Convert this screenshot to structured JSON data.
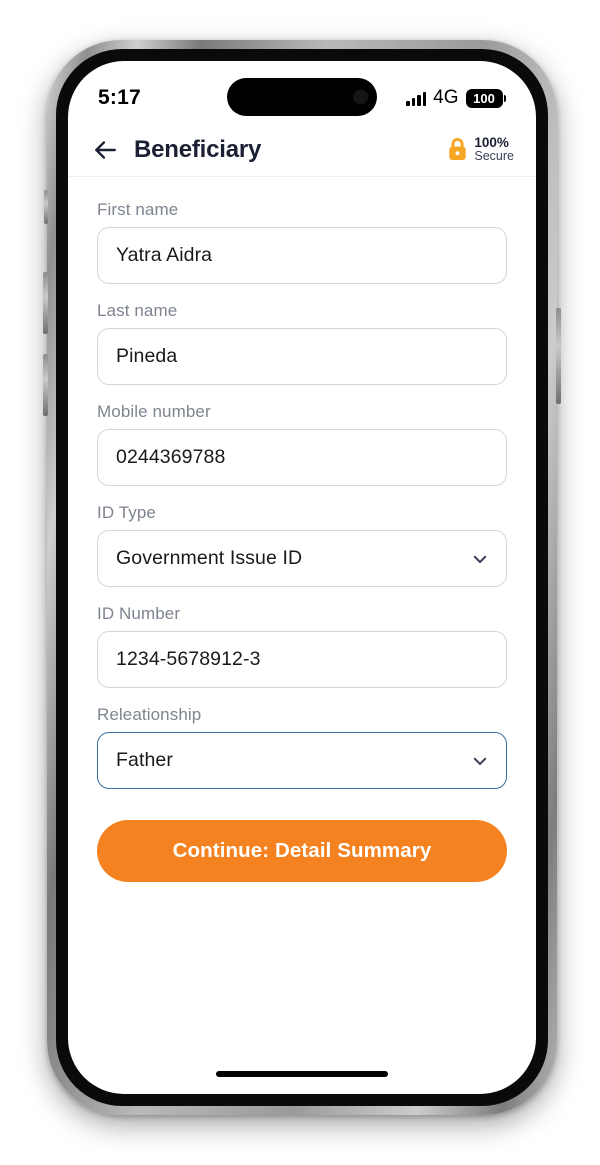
{
  "status_bar": {
    "time": "5:17",
    "network": "4G",
    "battery_level": "100",
    "signal_icon": "signal-bars-icon",
    "battery_icon": "battery-full-icon"
  },
  "header": {
    "back_icon": "arrow-left-icon",
    "title": "Beneficiary",
    "secure_badge": {
      "icon": "lock-icon",
      "percent": "100%",
      "label": "Secure",
      "icon_color": "#F5A623"
    }
  },
  "form": {
    "fields": [
      {
        "label": "First name",
        "value": "Yatra Aidra",
        "type": "text",
        "focused": false
      },
      {
        "label": "Last name",
        "value": "Pineda",
        "type": "text",
        "focused": false
      },
      {
        "label": "Mobile number",
        "value": "0244369788",
        "type": "text",
        "focused": false
      },
      {
        "label": "ID Type",
        "value": "Government Issue ID",
        "type": "select",
        "focused": false
      },
      {
        "label": "ID Number",
        "value": "1234-5678912-3",
        "type": "text",
        "focused": false
      },
      {
        "label": "Releationship",
        "value": "Father",
        "type": "select",
        "focused": true
      }
    ]
  },
  "cta": {
    "label": "Continue: Detail Summary",
    "color": "#F58220"
  },
  "colors": {
    "accent_orange": "#F58220",
    "focus_blue": "#3A6EA5",
    "label_gray": "#7E8490",
    "border_gray": "#D3D6DB",
    "title_navy": "#1B2033"
  }
}
